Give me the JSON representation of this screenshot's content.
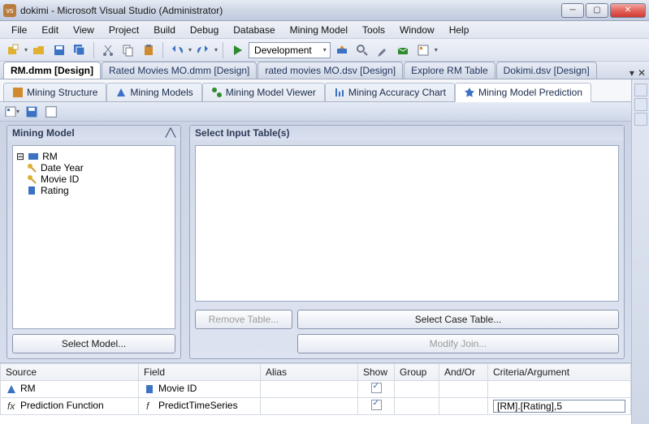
{
  "window": {
    "title": "dokimi - Microsoft Visual Studio (Administrator)"
  },
  "menu": [
    "File",
    "Edit",
    "View",
    "Project",
    "Build",
    "Debug",
    "Database",
    "Mining Model",
    "Tools",
    "Window",
    "Help"
  ],
  "toolbar": {
    "config": "Development"
  },
  "doc_tabs": [
    {
      "label": "RM.dmm [Design]",
      "active": true
    },
    {
      "label": "Rated Movies MO.dmm [Design]"
    },
    {
      "label": "rated movies MO.dsv [Design]"
    },
    {
      "label": "Explore RM Table"
    },
    {
      "label": "Dokimi.dsv [Design]"
    }
  ],
  "sub_tabs": [
    {
      "label": "Mining Structure"
    },
    {
      "label": "Mining Models"
    },
    {
      "label": "Mining Model Viewer"
    },
    {
      "label": "Mining Accuracy Chart"
    },
    {
      "label": "Mining Model Prediction",
      "active": true
    }
  ],
  "mining_model_panel": {
    "title": "Mining Model",
    "root": "RM",
    "children": [
      "Date Year",
      "Movie ID",
      "Rating"
    ],
    "select_btn": "Select Model..."
  },
  "input_panel": {
    "title": "Select Input Table(s)",
    "remove_btn": "Remove Table...",
    "case_btn": "Select Case Table...",
    "modify_btn": "Modify Join..."
  },
  "grid": {
    "headers": [
      "Source",
      "Field",
      "Alias",
      "Show",
      "Group",
      "And/Or",
      "Criteria/Argument"
    ],
    "rows": [
      {
        "source": "RM",
        "field": "Movie ID",
        "alias": "",
        "show": true,
        "group": "",
        "andor": "",
        "criteria": ""
      },
      {
        "source": "Prediction Function",
        "field": "PredictTimeSeries",
        "alias": "",
        "show": true,
        "group": "",
        "andor": "",
        "criteria": "[RM].[Rating],5"
      }
    ]
  }
}
